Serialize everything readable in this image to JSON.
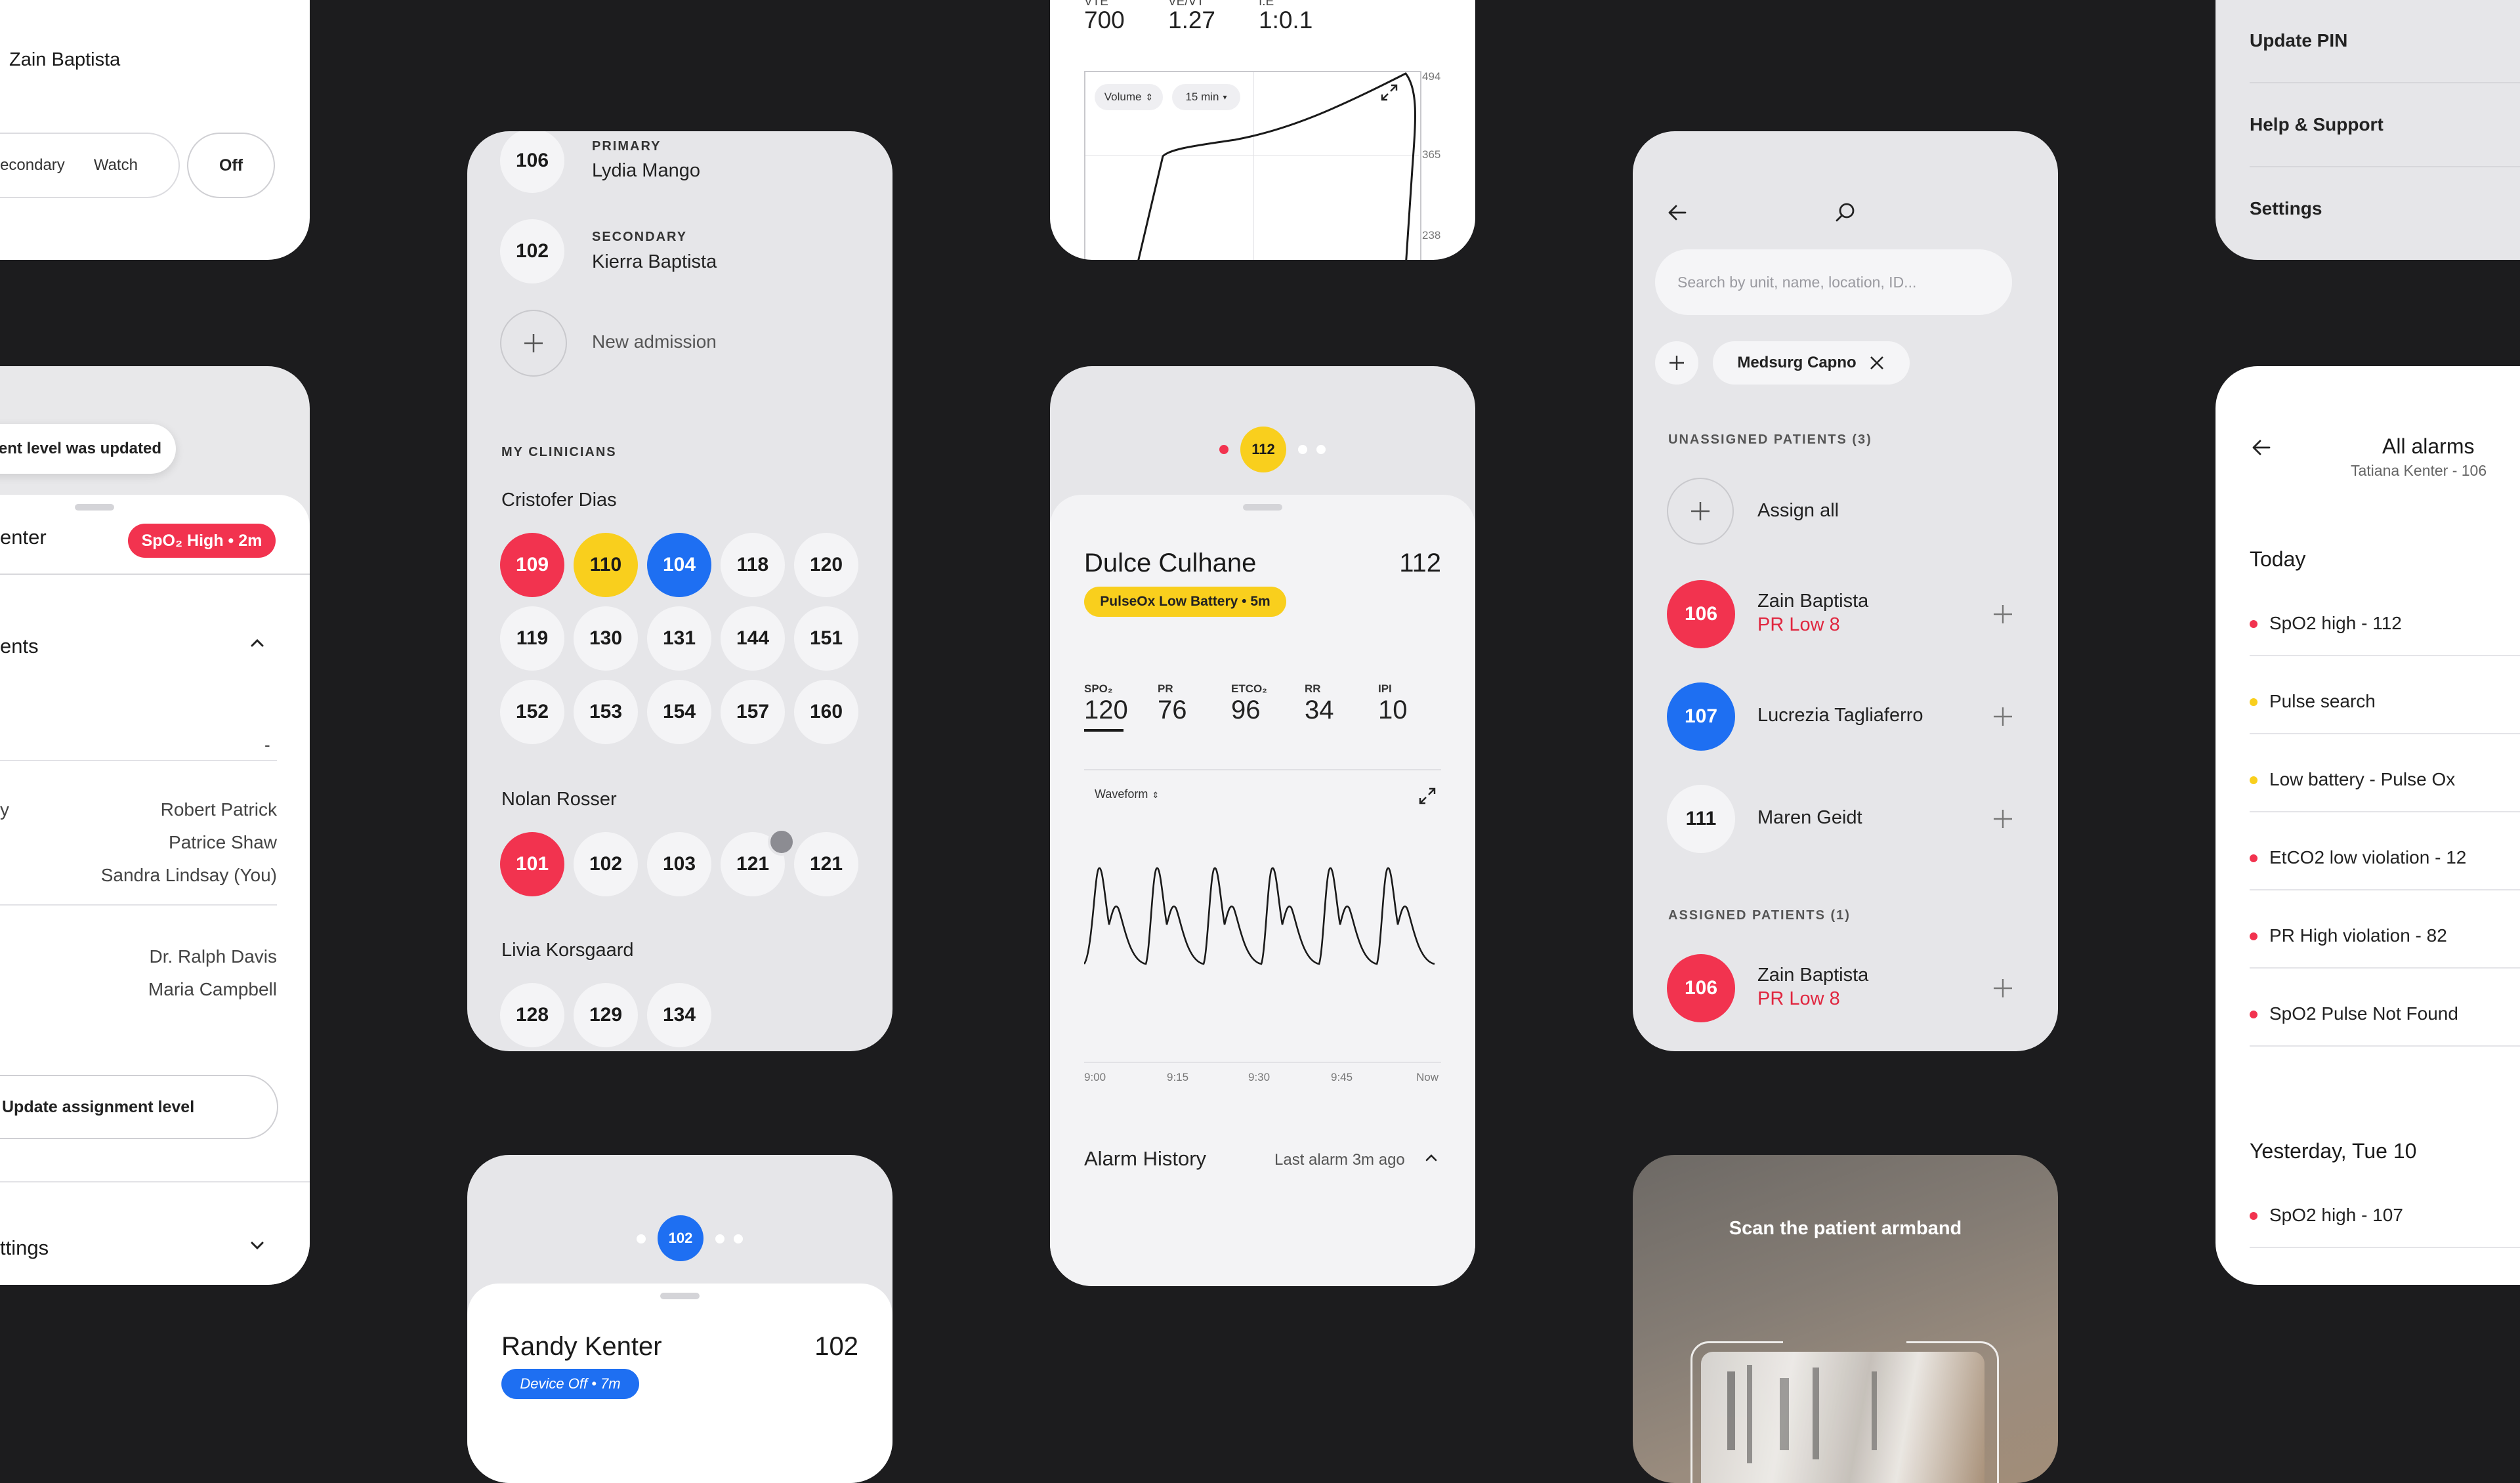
{
  "card1": {
    "name": "Zain Baptista",
    "seg_secondary": "Secondary",
    "seg_watch": "Watch",
    "seg_off": "Off"
  },
  "card2": {
    "toast": "Assignment level was updated",
    "header_partial": "enter",
    "alarm_badge": "SpO₂ High • 2m",
    "section_partial": "ents",
    "dash": "-",
    "label_partial": "y",
    "names_a": [
      "Robert Patrick",
      "Patrice Shaw",
      "Sandra Lindsay (You)"
    ],
    "names_b": [
      "Dr. Ralph Davis",
      "Maria Campbell"
    ],
    "update_button": "Update assignment level",
    "settings_partial": "ttings"
  },
  "card3": {
    "primary_unit": "106",
    "primary_label": "PRIMARY",
    "primary_name": "Lydia Mango",
    "secondary_unit": "102",
    "secondary_label": "SECONDARY",
    "secondary_name": "Kierra Baptista",
    "new_admission": "New admission",
    "my_clinicians": "MY CLINICIANS",
    "clinicians": [
      {
        "name": "Cristofer Dias",
        "units": [
          "109",
          "110",
          "104",
          "118",
          "120",
          "119",
          "130",
          "131",
          "144",
          "151",
          "152",
          "153",
          "154",
          "157",
          "160"
        ]
      },
      {
        "name": "Nolan Rosser",
        "units": [
          "101",
          "102",
          "103",
          "121",
          "121"
        ]
      },
      {
        "name": "Livia Korsgaard",
        "units": [
          "128",
          "129",
          "134"
        ]
      }
    ]
  },
  "card4": {
    "vt_label": "VTE",
    "vt_value": "700",
    "ve_label": "VE/VT",
    "ve_value": "1.27",
    "ie_label": "I:E",
    "ie_value": "1:0.1",
    "volume_select": "Volume",
    "time_select": "15 min",
    "y_ticks": [
      "494",
      "365",
      "238"
    ]
  },
  "card5": {
    "selected_unit": "112",
    "patient_name": "Dulce Culhane",
    "patient_unit": "112",
    "alarm_badge": "PulseOx Low Battery • 5m",
    "vitals": [
      {
        "label": "SPO₂",
        "value": "120"
      },
      {
        "label": "PR",
        "value": "76"
      },
      {
        "label": "ETCO₂",
        "value": "96"
      },
      {
        "label": "RR",
        "value": "34"
      },
      {
        "label": "IPI",
        "value": "10"
      }
    ],
    "waveform_select": "Waveform",
    "time_ticks": [
      "9:00",
      "9:15",
      "9:30",
      "9:45",
      "Now"
    ],
    "alarm_history": "Alarm History",
    "last_alarm": "Last alarm 3m ago"
  },
  "card6": {
    "selected_unit": "102",
    "patient_name": "Randy Kenter",
    "patient_unit": "102",
    "status_badge": "Device Off • 7m"
  },
  "card7": {
    "search_placeholder": "Search by unit, name, location, ID...",
    "filter_chip": "Medsurg Capno",
    "unassigned_header": "UNASSIGNED PATIENTS (3)",
    "assign_all": "Assign all",
    "unassigned": [
      {
        "unit": "106",
        "name": "Zain Baptista",
        "status": "PR Low 8",
        "color": "red"
      },
      {
        "unit": "107",
        "name": "Lucrezia Tagliaferro",
        "status": "",
        "color": "blue"
      },
      {
        "unit": "111",
        "name": "Maren Geidt",
        "status": "",
        "color": "none"
      }
    ],
    "assigned_header": "ASSIGNED PATIENTS (1)",
    "assigned": [
      {
        "unit": "106",
        "name": "Zain Baptista",
        "status": "PR Low 8",
        "color": "red"
      }
    ]
  },
  "card8": {
    "scan_title": "Scan the patient armband"
  },
  "card9": {
    "menu": [
      "Update PIN",
      "Help & Support",
      "Settings"
    ]
  },
  "card10": {
    "title": "All alarms",
    "subtitle": "Tatiana Kenter - 106",
    "today": "Today",
    "alarms_today": [
      {
        "text": "SpO2 high - 112",
        "color": "#f2334f"
      },
      {
        "text": "Pulse search",
        "color": "#f9cf1d"
      },
      {
        "text": "Low battery - Pulse Ox",
        "color": "#f9cf1d"
      },
      {
        "text": "EtCO2 low violation - 12",
        "color": "#f2334f"
      },
      {
        "text": "PR High violation - 82",
        "color": "#f2334f"
      },
      {
        "text": "SpO2 Pulse Not Found",
        "color": "#f2334f"
      }
    ],
    "yesterday": "Yesterday, Tue 10",
    "alarms_yesterday": [
      {
        "text": "SpO2 high - 107",
        "color": "#f2334f"
      }
    ]
  }
}
